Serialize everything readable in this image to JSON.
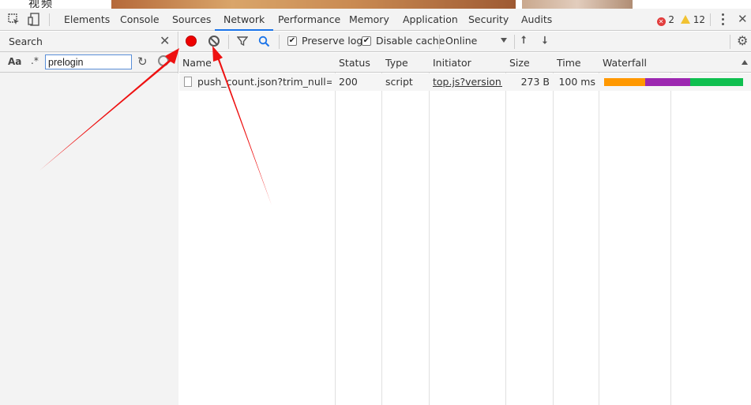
{
  "page_strip": {
    "cjk_text": "视频"
  },
  "tabs": [
    {
      "label": "Elements"
    },
    {
      "label": "Console"
    },
    {
      "label": "Sources"
    },
    {
      "label": "Network",
      "active": true
    },
    {
      "label": "Performance"
    },
    {
      "label": "Memory"
    },
    {
      "label": "Application"
    },
    {
      "label": "Security"
    },
    {
      "label": "Audits"
    }
  ],
  "status": {
    "errors": "2",
    "warnings": "12",
    "error_color": "#e23d3d",
    "warning_color": "#f1c232"
  },
  "search_panel": {
    "title": "Search",
    "case_toggle": "Aa",
    "regex_toggle": ".*",
    "query": "prelogin"
  },
  "toolbar": {
    "preserve_log": "Preserve log",
    "disable_cache": "Disable cache",
    "throttling": "Online",
    "record_color": "#ee0000"
  },
  "columns": [
    "Name",
    "Status",
    "Type",
    "Initiator",
    "Size",
    "Time",
    "Waterfall"
  ],
  "requests": [
    {
      "name": "push_count.json?trim_null=1&...",
      "status": "200",
      "type": "script",
      "initiator": "top.js?version...",
      "size": "273 B",
      "time": "100 ms"
    }
  ],
  "waterfall_colors": {
    "waiting": "#ff9800",
    "ttfb": "#9c27b0",
    "download": "#0fbf4f"
  },
  "annotation_color": "#ee1111"
}
